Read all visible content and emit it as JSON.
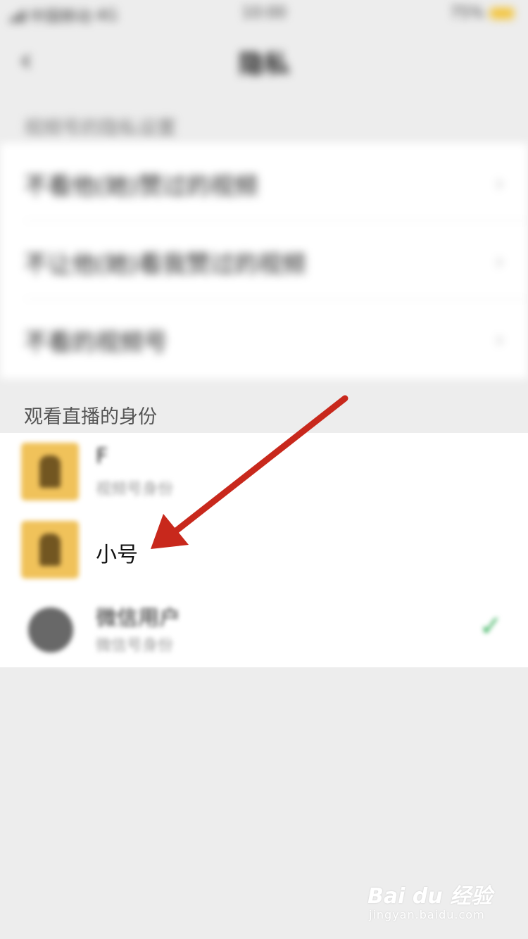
{
  "status_bar": {
    "carrier": "中国移动",
    "network": "4G",
    "time": "10:00",
    "battery": "75%"
  },
  "nav": {
    "back": "‹",
    "title": "隐私"
  },
  "section1": {
    "label": "视频号的隐私设置",
    "items": [
      {
        "label": "不看他(她)赞过的视频",
        "chevron": "›"
      },
      {
        "label": "不让他(她)看我赞过的视频",
        "chevron": "›"
      },
      {
        "label": "不看的视频号",
        "chevron": "›"
      }
    ]
  },
  "section2": {
    "label": "观看直播的身份",
    "identities": [
      {
        "name": "F",
        "sub": "视频号身份"
      },
      {
        "name": "小号"
      },
      {
        "name": "微信用户",
        "sub": "微信号身份",
        "selected_mark": "✓"
      }
    ]
  },
  "annotation": {
    "arrow_color": "#c8281c"
  },
  "watermark": {
    "logo": "Bai du 经验",
    "sub": "jingyan.baidu.com"
  },
  "colors": {
    "accent_green": "#3bb25e",
    "avatar_yellow": "#f0c25a",
    "background": "#ededed"
  }
}
